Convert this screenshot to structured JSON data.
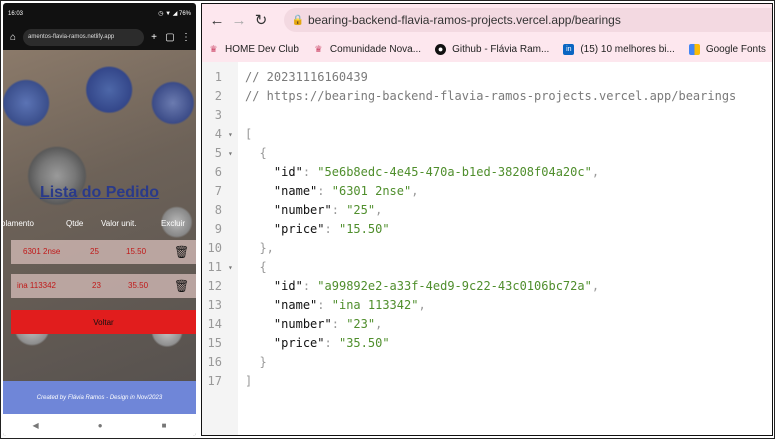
{
  "phone": {
    "status_time": "16:03",
    "status_right": "◷ ▼ ◢ 76%",
    "url": "amentos-flavia-ramos.netlify.app",
    "title": "Lista do Pedido",
    "columns": [
      "olamento",
      "Qtde",
      "Valor unit.",
      "Excluir"
    ],
    "rows": [
      {
        "name": "6301 2nse",
        "qty": "25",
        "price": "15.50"
      },
      {
        "name": "ina 113342",
        "qty": "23",
        "price": "35.50"
      }
    ],
    "button_label": "Voltar",
    "footer": "Created by Flávia Ramos - Design in Nov/2023"
  },
  "browser": {
    "url": "bearing-backend-flavia-ramos-projects.vercel.app/bearings",
    "bookmarks": [
      {
        "label": "HOME Dev Club",
        "icon": "bookmark-icon"
      },
      {
        "label": "Comunidade Nova...",
        "icon": "bookmark-icon"
      },
      {
        "label": "Github - Flávia Ram...",
        "icon": "github-icon"
      },
      {
        "label": "(15) 10 melhores bi...",
        "icon": "linkedin-icon"
      },
      {
        "label": "Google Fonts",
        "icon": "google-fonts-icon"
      }
    ],
    "code": {
      "comment1": "// 20231116160439",
      "comment2": "// https://bearing-backend-flavia-ramos-projects.vercel.app/bearings",
      "items": [
        {
          "id": "5e6b8edc-4e45-470a-b1ed-38208f04a20c",
          "name": "6301 2nse",
          "number": "25",
          "price": "15.50"
        },
        {
          "id": "a99892e2-a33f-4ed9-9c22-43c0106bc72a",
          "name": "ina 113342",
          "number": "23",
          "price": "35.50"
        }
      ],
      "keys": {
        "id": "id",
        "name": "name",
        "number": "number",
        "price": "price"
      },
      "line_numbers": [
        "1",
        "2",
        "3",
        "4",
        "5",
        "6",
        "7",
        "8",
        "9",
        "10",
        "11",
        "12",
        "13",
        "14",
        "15",
        "16",
        "17"
      ]
    }
  },
  "colors": {
    "accent_red": "#e11d1d",
    "title_blue": "#2a3a8a",
    "footer_blue": "#6f86d8",
    "json_string": "#4f8e2c"
  }
}
